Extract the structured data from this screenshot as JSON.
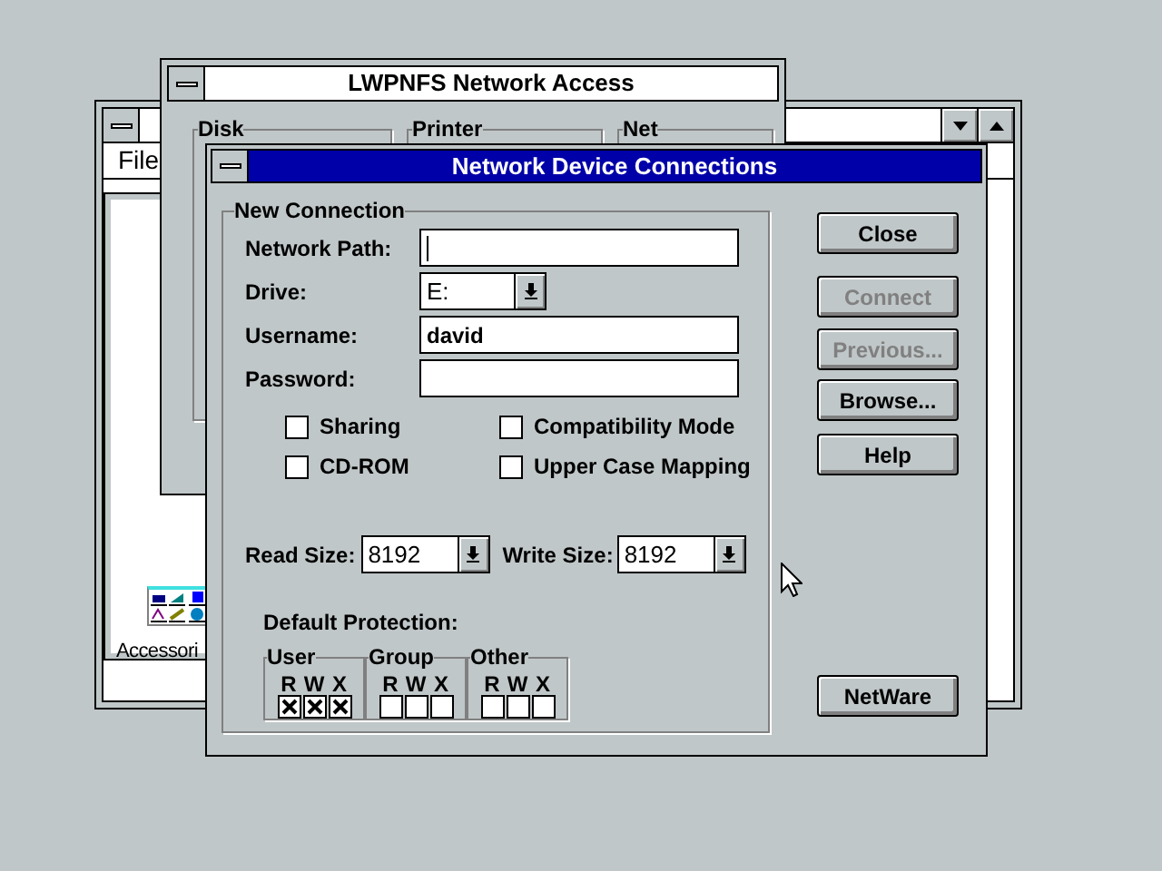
{
  "program_manager": {
    "menu": [
      {
        "label": "File"
      }
    ],
    "group_icon_label": "Accessori"
  },
  "lwpnfs_window": {
    "title": "LWPNFS Network Access",
    "groups": [
      {
        "label": "Disk"
      },
      {
        "label": "Printer"
      },
      {
        "label": "Net"
      }
    ]
  },
  "dialog": {
    "title": "Network Device Connections",
    "new_connection": {
      "title": "New Connection",
      "fields": [
        {
          "kind": "text",
          "label": "Network Path:",
          "focused": true
        },
        {
          "kind": "dropdown",
          "label": "Drive:",
          "value": "E:",
          "focused": false
        },
        {
          "kind": "text",
          "label": "Username:",
          "value": "david",
          "focused": false
        },
        {
          "kind": "text",
          "label": "Password:",
          "focused": false
        }
      ],
      "options": [
        {
          "label": "Sharing",
          "checked": false
        },
        {
          "label": "Compatibility Mode",
          "checked": false
        },
        {
          "label": "CD-ROM",
          "checked": false
        },
        {
          "label": "Upper Case Mapping",
          "checked": false
        }
      ],
      "sizes": [
        {
          "label": "Read Size:",
          "value": "8192"
        },
        {
          "label": "Write Size:",
          "value": "8192"
        }
      ],
      "protection": {
        "title": "Default Protection:",
        "classes": [
          {
            "label": "User",
            "bits": [
              {
                "label": "R",
                "checked": true
              },
              {
                "label": "W",
                "checked": true
              },
              {
                "label": "X",
                "checked": true
              }
            ]
          },
          {
            "label": "Group",
            "bits": [
              {
                "label": "R",
                "checked": false
              },
              {
                "label": "W",
                "checked": false
              },
              {
                "label": "X",
                "checked": false
              }
            ]
          },
          {
            "label": "Other",
            "bits": [
              {
                "label": "R",
                "checked": false
              },
              {
                "label": "W",
                "checked": false
              },
              {
                "label": "X",
                "checked": false
              }
            ]
          }
        ]
      }
    },
    "buttons": [
      {
        "kind": "top",
        "label": "Close",
        "disabled": false
      },
      {
        "kind": "top",
        "label": "Connect",
        "disabled": true
      },
      {
        "kind": "top",
        "label": "Previous...",
        "disabled": true
      },
      {
        "kind": "top",
        "label": "Browse...",
        "disabled": false
      },
      {
        "kind": "top",
        "label": "Help",
        "disabled": false
      },
      {
        "kind": "bottom",
        "label": "NetWare",
        "disabled": false
      }
    ]
  }
}
